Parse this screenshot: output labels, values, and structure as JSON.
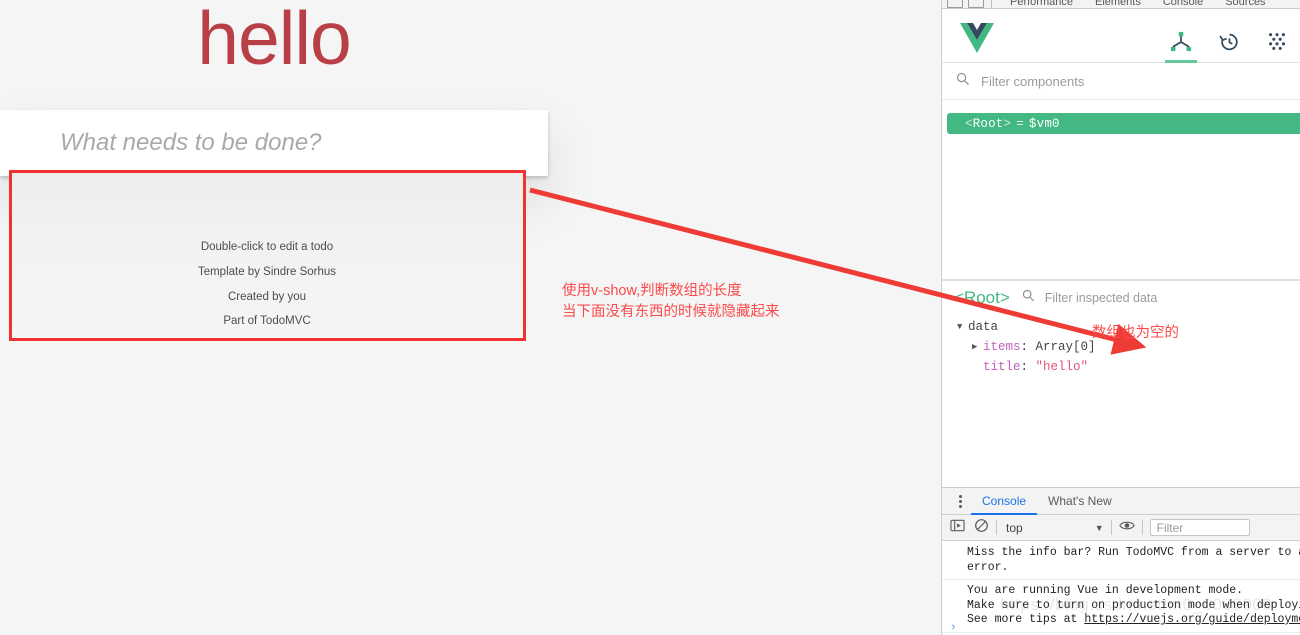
{
  "page": {
    "title": "hello",
    "new_todo_placeholder": "What needs to be done?",
    "info_lines": [
      "Double-click to edit a todo",
      "Template by Sindre Sorhus",
      "Created by you",
      "Part of TodoMVC"
    ]
  },
  "annotations": {
    "note_line1": "使用v-show,判断数组的长度",
    "note_line2": "当下面没有东西的时候就隐藏起来",
    "note_right": "数组也为空的",
    "highlight_color": "#f03232",
    "note_color": "#fb4a4a"
  },
  "devtools": {
    "chrome_tabs": [
      "Performance",
      "Elements",
      "Console",
      "Sources"
    ],
    "vue": {
      "tabs": [
        {
          "name": "components-tab",
          "icon": "component-tree-icon",
          "active": true
        },
        {
          "name": "timetravel-tab",
          "icon": "history-clock-icon",
          "active": false
        },
        {
          "name": "vuex-tab",
          "icon": "dots-grid-icon",
          "active": false
        }
      ],
      "filter_components_placeholder": "Filter components",
      "filter_components_value": "",
      "tree": [
        {
          "open_angle": "<",
          "name": "Root",
          "close_angle": ">",
          "equals": "=",
          "vm": "$vm0",
          "selected": true
        }
      ],
      "inspector": {
        "selected_component": "<Root>",
        "filter_placeholder": "Filter inspected data",
        "filter_value": "",
        "groups": [
          {
            "label": "data",
            "expanded": true,
            "entries": [
              {
                "key": "items",
                "value": "Array[0]",
                "kind": "array",
                "expandable": true
              },
              {
                "key": "title",
                "value": "\"hello\"",
                "kind": "string",
                "expandable": false
              }
            ]
          }
        ]
      }
    },
    "drawer": {
      "tabs": [
        {
          "label": "Console",
          "active": true
        },
        {
          "label": "What's New",
          "active": false
        }
      ],
      "toolbar": {
        "context_value": "top",
        "filter_placeholder": "Filter",
        "filter_value": "",
        "icons": [
          "sidebar-toggle-icon",
          "clear-console-icon",
          "eye-icon"
        ]
      },
      "messages": [
        {
          "text": "Miss the info bar? Run TodoMVC from a server to avo\nerror.",
          "link": null
        },
        {
          "text": "You are running Vue in development mode.\nMake sure to turn on production mode when deploying\nSee more tips at ",
          "link": "https://vuejs.org/guide/deployment"
        }
      ],
      "prompt_symbol": "›"
    }
  },
  "watermark": "https://blog.csdn.net/m0_0000000"
}
